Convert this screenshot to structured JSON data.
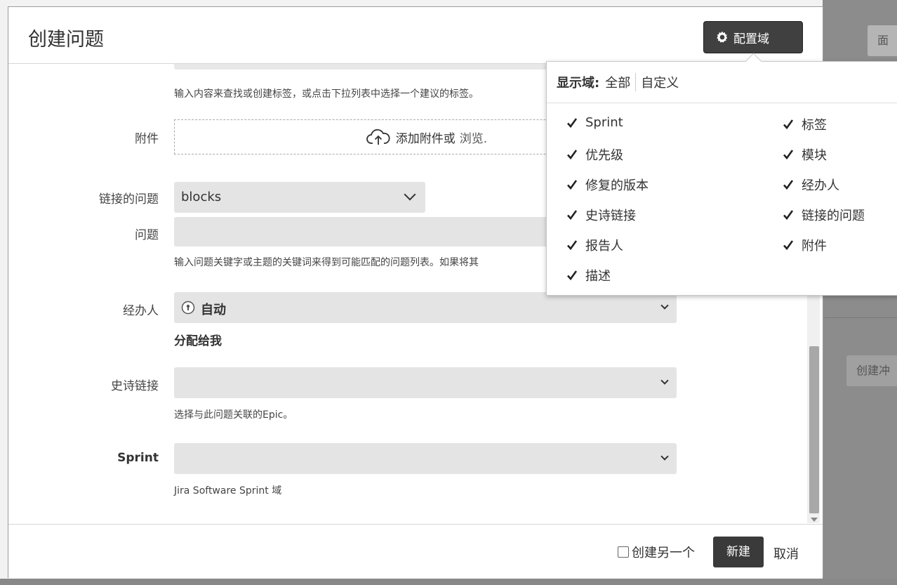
{
  "background": {
    "top_button_label": "面",
    "create_button_label": "创建冲"
  },
  "dialog": {
    "title": "创建问题",
    "config_button_label": "配置域"
  },
  "fields": {
    "labels_help": "输入内容来查找或创建标签，或点击下拉列表中选择一个建议的标签。",
    "attachment_label": "附件",
    "attachment_drop_text": "添加附件或",
    "attachment_browse_text": "浏览.",
    "linked_issues_label": "链接的问题",
    "linked_issues_value": "blocks",
    "issue_label": "问题",
    "issue_value": "",
    "issue_help": "输入问题关键字或主题的关键词来得到可能匹配的问题列表。如果将其",
    "assignee_label": "经办人",
    "assignee_value": "自动",
    "assign_to_me": "分配给我",
    "epic_link_label": "史诗链接",
    "epic_link_value": "",
    "epic_link_help": "选择与此问题关联的Epic。",
    "sprint_label": "Sprint",
    "sprint_value": "",
    "sprint_help": "Jira Software Sprint 域"
  },
  "footer": {
    "create_another_label": "创建另一个",
    "create_another_checked": false,
    "create_button": "新建",
    "cancel_link": "取消"
  },
  "config_popup": {
    "show_fields_label": "显示域:",
    "option_all": "全部",
    "option_custom": "自定义",
    "left_items": [
      "Sprint",
      "优先级",
      "修复的版本",
      "史诗链接",
      "报告人",
      "描述"
    ],
    "right_items": [
      "标签",
      "模块",
      "经办人",
      "链接的问题",
      "附件"
    ],
    "all_checked": true
  }
}
